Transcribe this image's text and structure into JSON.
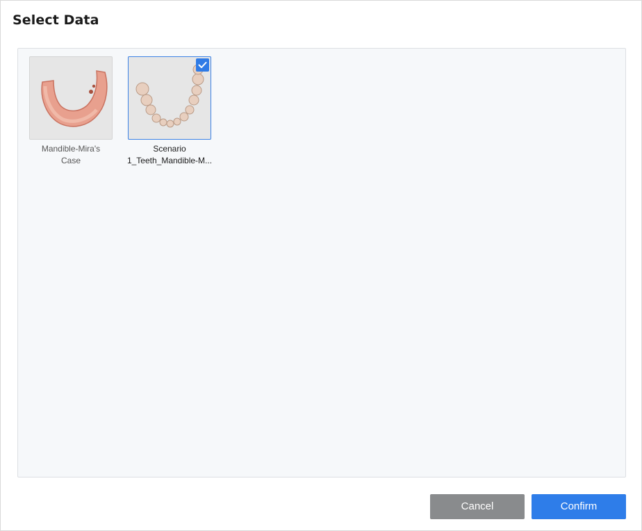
{
  "dialog": {
    "title": "Select Data"
  },
  "items": [
    {
      "label_line1": "Mandible-Mira's",
      "label_line2": "Case",
      "selected": false,
      "icon": "jaw-scan-thumbnail"
    },
    {
      "label_line1": "Scenario",
      "label_line2": "1_Teeth_Mandible-M...",
      "selected": true,
      "icon": "teeth-scan-thumbnail"
    }
  ],
  "buttons": {
    "cancel": "Cancel",
    "confirm": "Confirm"
  },
  "colors": {
    "accent": "#2e7de9",
    "cancel": "#898b8d",
    "panel": "#f6f8fa"
  }
}
